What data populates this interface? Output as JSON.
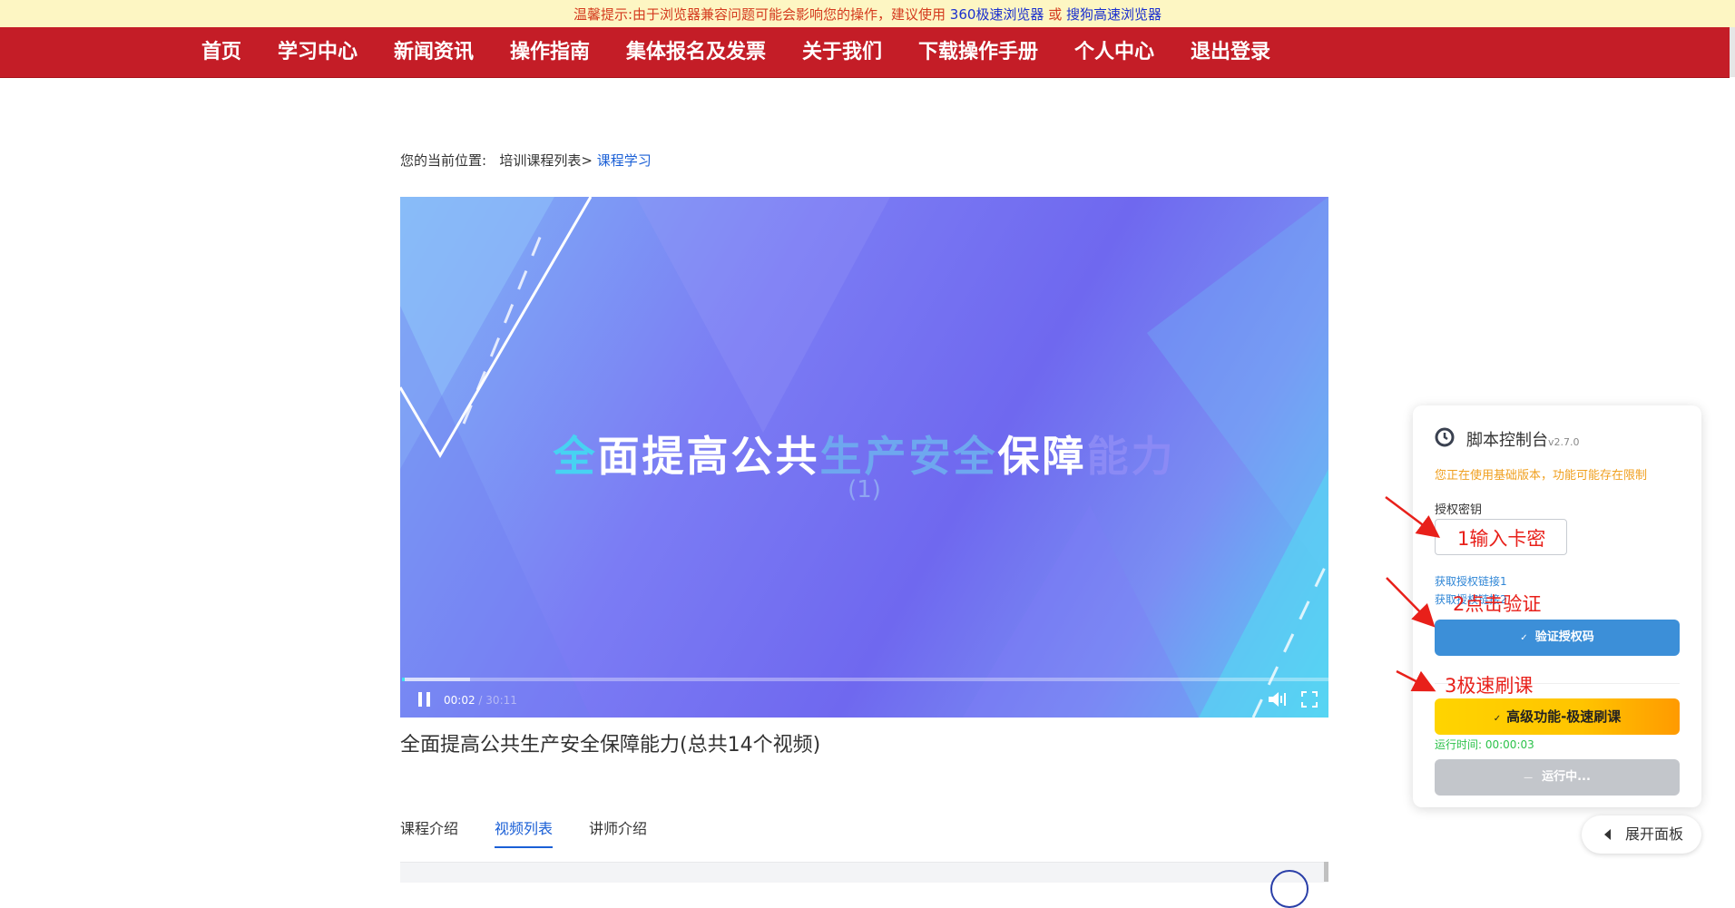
{
  "notice": {
    "prefix": "温馨提示:由于浏览器兼容问题可能会影响您的操作，建议使用",
    "browser1": "360极速浏览器",
    "or": "或",
    "browser2": "搜狗高速浏览器"
  },
  "nav": {
    "items": [
      {
        "label": "首页"
      },
      {
        "label": "学习中心"
      },
      {
        "label": "新闻资讯"
      },
      {
        "label": "操作指南"
      },
      {
        "label": "集体报名及发票"
      },
      {
        "label": "关于我们"
      },
      {
        "label": "下载操作手册"
      },
      {
        "label": "个人中心"
      },
      {
        "label": "退出登录"
      }
    ]
  },
  "breadcrumb": {
    "prefix": "您的当前位置:",
    "parent": "培训课程列表>",
    "current": "课程学习"
  },
  "player": {
    "title_parts": [
      "全",
      "面提高公共",
      "生产安全",
      "保障",
      "能力"
    ],
    "subtitle": "(1)",
    "current_time": "00:02",
    "separator": "/",
    "duration": "30:11",
    "progress_fraction": 0.0011,
    "buffered_fraction": 0.073
  },
  "course": {
    "title": "全面提高公共生产安全保障能力(总共14个视频)"
  },
  "tabs": [
    {
      "label": "课程介绍",
      "active": false
    },
    {
      "label": "视频列表",
      "active": true
    },
    {
      "label": "讲师介绍",
      "active": false
    }
  ],
  "panel": {
    "title": "脚本控制台",
    "version": "v2.7.0",
    "warning": "您正在使用基础版本，功能可能存在限制",
    "key_label": "授权密钥",
    "link1": "获取授权链接1",
    "link2": "获取授权链接2",
    "verify_label": "验证授权码",
    "fast_label": "高级功能-极速刷课",
    "run_time": "运行时间: 00:00:03",
    "running_label": "运行中...",
    "check_glyph": "✓",
    "dash_glyph": "—",
    "clock_icon": "clock-icon",
    "colors": {
      "verify": "#3c8fd8",
      "fast": "#ffd400",
      "running": "#c3c6cb",
      "warn": "#f0a020",
      "runtime": "#2cc24a"
    }
  },
  "annotations": {
    "step1": "1输入卡密",
    "step2": "2点击验证",
    "step3": "3极速刷课"
  },
  "expand": {
    "label": "展开面板"
  },
  "colors": {
    "nav_bg": "#c41d27",
    "notice_bg": "#fdf6c3",
    "accent": "#1a5fd6",
    "annotation": "#e8201a"
  }
}
